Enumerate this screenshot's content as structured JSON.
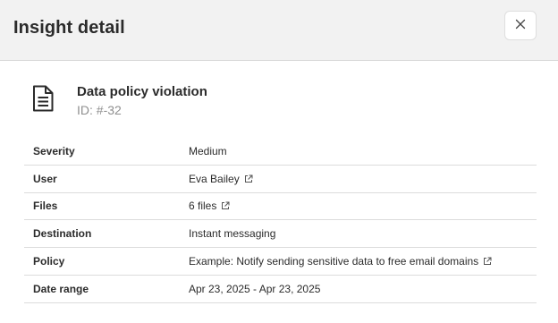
{
  "header": {
    "title": "Insight detail",
    "close_icon": "close-icon"
  },
  "summary": {
    "icon": "document-icon",
    "title": "Data policy violation",
    "id": "ID: #-32"
  },
  "details": [
    {
      "label": "Severity",
      "value": "Medium",
      "link": false
    },
    {
      "label": "User",
      "value": "Eva Bailey",
      "link": true
    },
    {
      "label": "Files",
      "value": "6 files",
      "link": true
    },
    {
      "label": "Destination",
      "value": "Instant messaging",
      "link": false
    },
    {
      "label": "Policy",
      "value": "Example: Notify sending sensitive data to free email domains",
      "link": true
    },
    {
      "label": "Date range",
      "value": "Apr 23, 2025 - Apr 23, 2025",
      "link": false
    }
  ]
}
